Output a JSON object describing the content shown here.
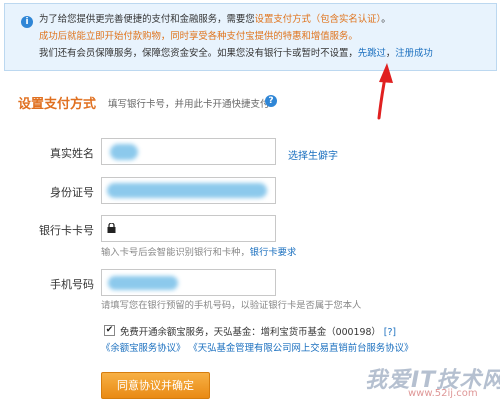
{
  "notice": {
    "icon": "info-icon",
    "line1_pre": "为了给您提供更完善便捷的支付和金融服务，需要您",
    "line1_link": "设置支付方式（包含实名认证）",
    "line1_post": "。",
    "line2": "成功后就能立即开始付款购物，同时享受各种支付宝提供的特惠和增值服务。",
    "line3_pre": "我们还有会员保障服务，保障您资金安全。如果您没有银行卡或暂时不设置，",
    "skip_link": "先跳过",
    "separator": "，",
    "register_success": "注册成功"
  },
  "section": {
    "title": "设置支付方式",
    "hint": "填写银行卡号，并用此卡开通快捷支付",
    "help_icon": "question-icon"
  },
  "form": {
    "name_label": "真实姓名",
    "rare_char_link": "选择生僻字",
    "id_label": "身份证号",
    "card_label": "银行卡卡号",
    "card_icon": "lock-icon",
    "card_hint_pre": "输入卡号后会智能识别银行和卡种，",
    "card_hint_link": "银行卡要求",
    "phone_label": "手机号码",
    "phone_hint": "请填写您在银行预留的手机号码，以验证银行卡是否属于您本人",
    "agree_checked": "✔",
    "agree_text": "免费开通余额宝服务，天弘基金：增利宝货币基金（000198）",
    "agree_q": "[?]",
    "agreements": "《余额宝服务协议》 《天弘基金管理有限公司网上交易直销前台服务协议》",
    "submit_label": "同意协议并确定"
  },
  "watermark": {
    "text": "我爱IT技术网",
    "url": "www.52ij.com"
  },
  "colors": {
    "accent": "#e07020",
    "link": "#1a6fbf",
    "notice_bg": "#e8f3fd",
    "button": "#f0a030",
    "annotation_arrow": "#e02020"
  }
}
